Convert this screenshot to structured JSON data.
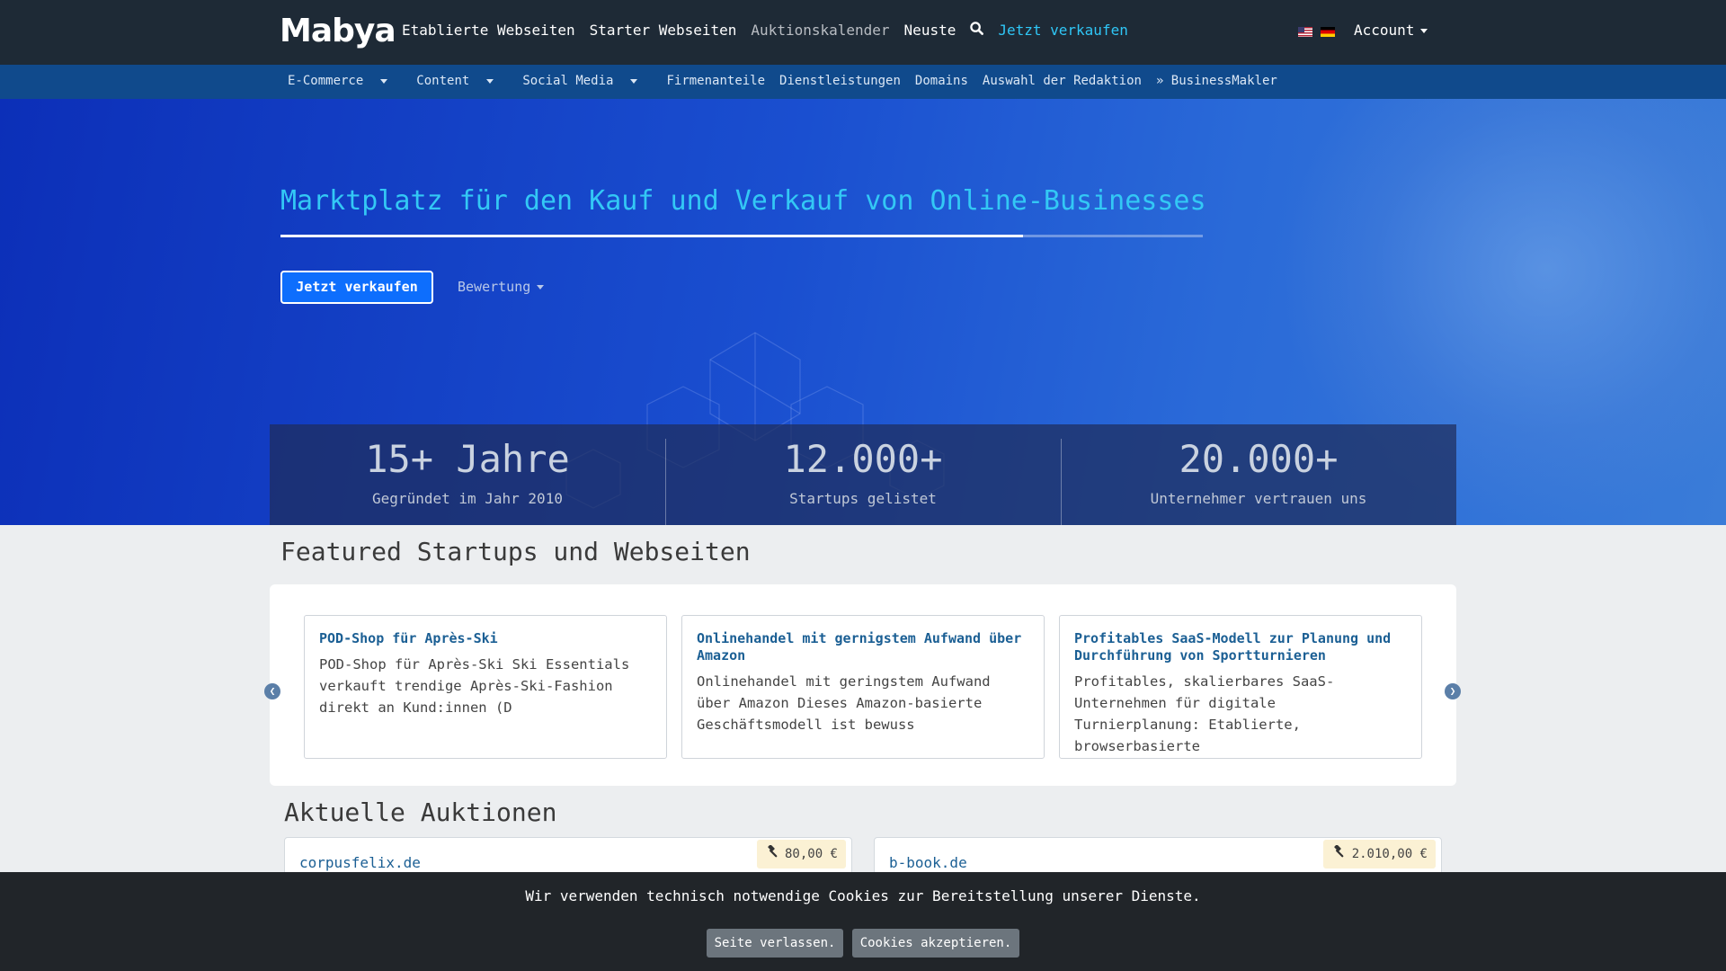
{
  "nav": {
    "brand": "Mabya",
    "links": [
      "Etablierte Webseiten",
      "Starter Webseiten",
      "Auktionskalender",
      "Neuste"
    ],
    "sell": "Jetzt verkaufen",
    "account": "Account"
  },
  "subnav": {
    "items": [
      "E-Commerce",
      "Content",
      "Social Media",
      "Firmenanteile",
      "Dienstleistungen",
      "Domains",
      "Auswahl der Redaktion",
      "» BusinessMakler"
    ]
  },
  "hero": {
    "title": "Marktplatz für den Kauf und Verkauf von Online-Businesses",
    "sell_button": "Jetzt verkaufen",
    "rating": "Bewertung",
    "progress": 0.805
  },
  "stats": [
    {
      "value": "15+ Jahre",
      "label": "Gegründet im Jahr 2010"
    },
    {
      "value": "12.000+",
      "label": "Startups gelistet"
    },
    {
      "value": "20.000+",
      "label": "Unternehmer vertrauen uns"
    }
  ],
  "featured": {
    "title": "Featured Startups und Webseiten",
    "cards": [
      {
        "title": "POD-Shop für Après-Ski",
        "desc": "POD-Shop für Après-Ski Ski Essentials verkauft trendige Après-Ski-Fashion direkt an Kund:innen (D"
      },
      {
        "title": "Onlinehandel mit gernigstem Aufwand über Amazon",
        "desc": "Onlinehandel mit geringstem Aufwand über Amazon Dieses Amazon-basierte Geschäftsmodell ist bewuss"
      },
      {
        "title": "Profitables SaaS-Modell zur Planung und Durchführung von Sportturnieren",
        "desc": "Profitables, skalierbares SaaS-Unternehmen für digitale Turnierplanung: Etablierte, browserbasierte"
      }
    ]
  },
  "auctions": {
    "title": "Aktuelle Auktionen",
    "items": [
      {
        "name": "corpusfelix.de",
        "price": "80,00 €"
      },
      {
        "name": "b-book.de",
        "price": "2.010,00 €"
      }
    ]
  },
  "cookie": {
    "text": "Wir verwenden technisch notwendige Cookies zur Bereitstellung unserer Dienste.",
    "leave": "Seite verlassen.",
    "accept": "Cookies akzeptieren."
  },
  "icons": {
    "search": "search-icon",
    "gavel": "gavel-icon",
    "prev": "chevron-left-icon",
    "next": "chevron-right-icon"
  }
}
